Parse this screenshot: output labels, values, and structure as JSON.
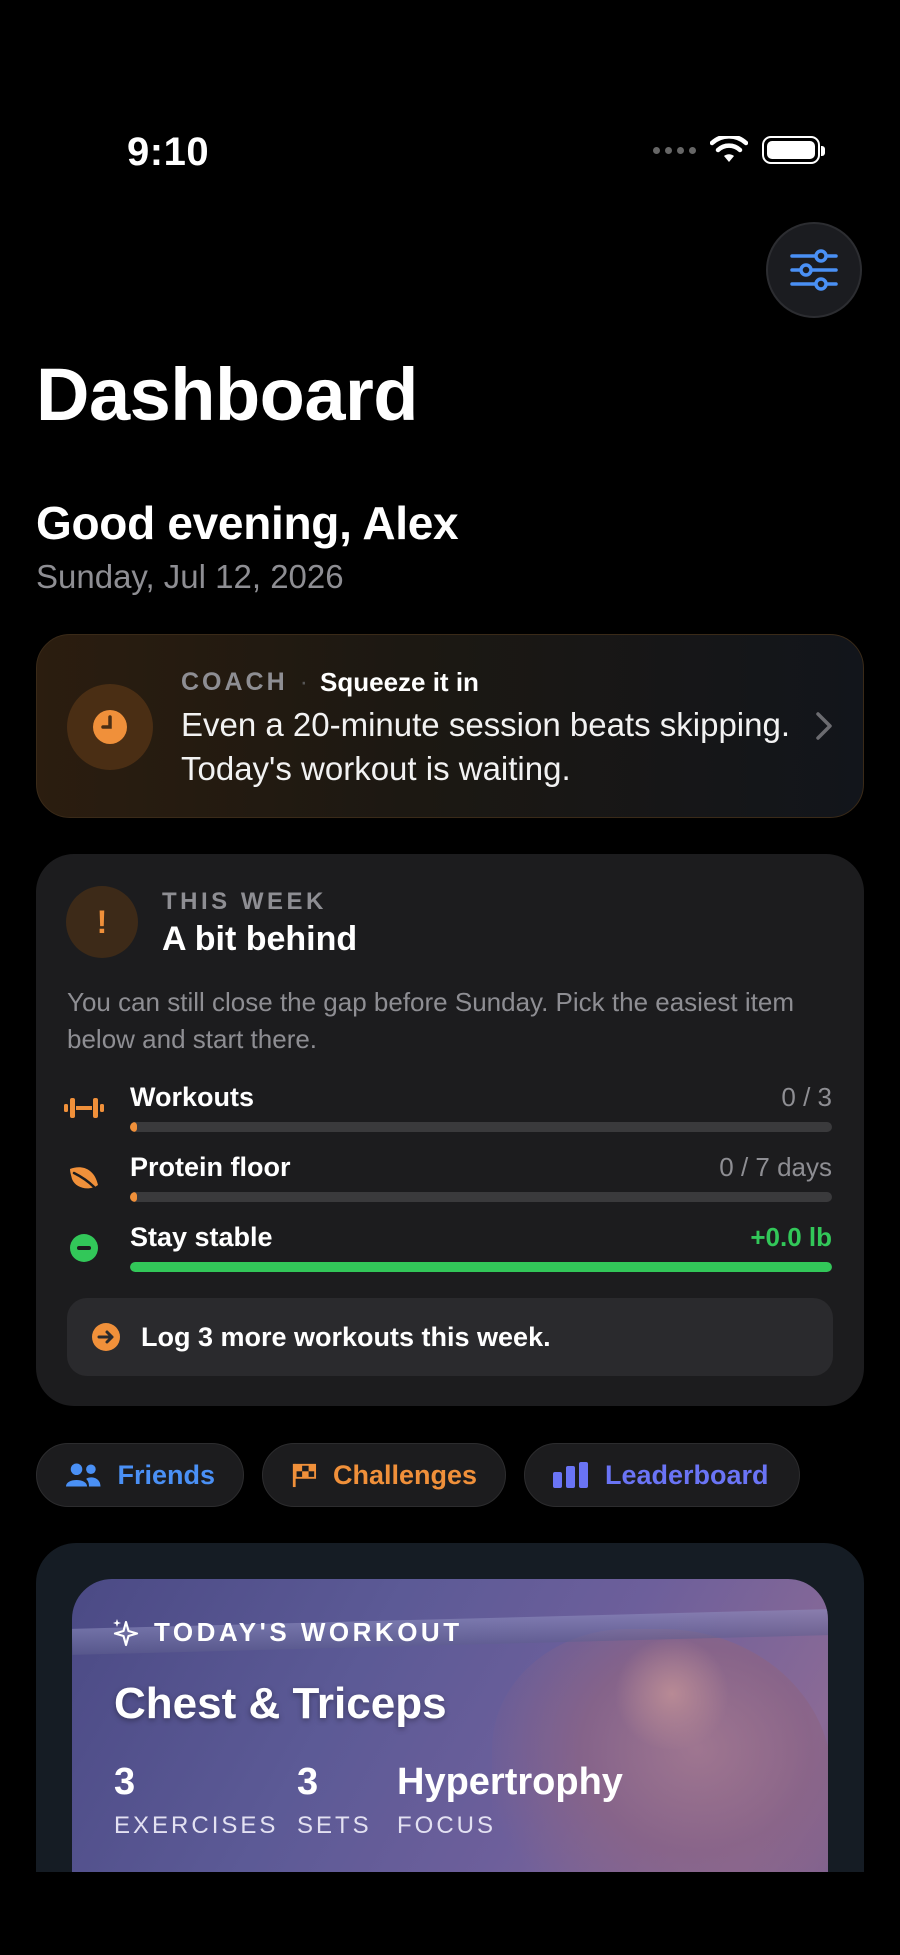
{
  "status_bar": {
    "time": "9:10"
  },
  "header": {
    "title": "Dashboard"
  },
  "greeting": {
    "text": "Good evening, Alex",
    "date": "Sunday, Jul 12, 2026"
  },
  "coach": {
    "tag": "COACH",
    "separator": "·",
    "headline": "Squeeze it in",
    "body": "Even a 20-minute session beats skipping. Today's workout is waiting."
  },
  "week": {
    "eyebrow": "THIS WEEK",
    "title": "A bit behind",
    "icon_glyph": "!",
    "description": "You can still close the gap before Sunday. Pick the easiest item below and start there.",
    "metrics": [
      {
        "label": "Workouts",
        "value": "0 / 3",
        "progress": 0.01,
        "color": "#f0903a",
        "icon": "dumbbell-icon"
      },
      {
        "label": "Protein floor",
        "value": "0 / 7 days",
        "progress": 0.01,
        "color": "#f0903a",
        "icon": "leaf-icon"
      },
      {
        "label": "Stay stable",
        "value": "+0.0 lb",
        "progress": 1.0,
        "color": "#32c759",
        "icon": "minus-circle-icon"
      }
    ],
    "tip": "Log 3 more workouts this week."
  },
  "chips": [
    {
      "label": "Friends",
      "icon": "people-icon",
      "color": "#4a90f5"
    },
    {
      "label": "Challenges",
      "icon": "checkered-flag-icon",
      "color": "#f0903a"
    },
    {
      "label": "Leaderboard",
      "icon": "bar-chart-icon",
      "color": "#6a74f5"
    }
  ],
  "workout": {
    "eyebrow": "TODAY'S WORKOUT",
    "title": "Chest & Triceps",
    "stats": [
      {
        "value": "3",
        "label": "EXERCISES"
      },
      {
        "value": "3",
        "label": "SETS"
      },
      {
        "value": "Hypertrophy",
        "label": "FOCUS"
      }
    ]
  },
  "colors": {
    "accent_orange": "#f0903a",
    "accent_green": "#32c759",
    "accent_blue": "#4a90f5",
    "accent_indigo": "#6a74f5"
  }
}
